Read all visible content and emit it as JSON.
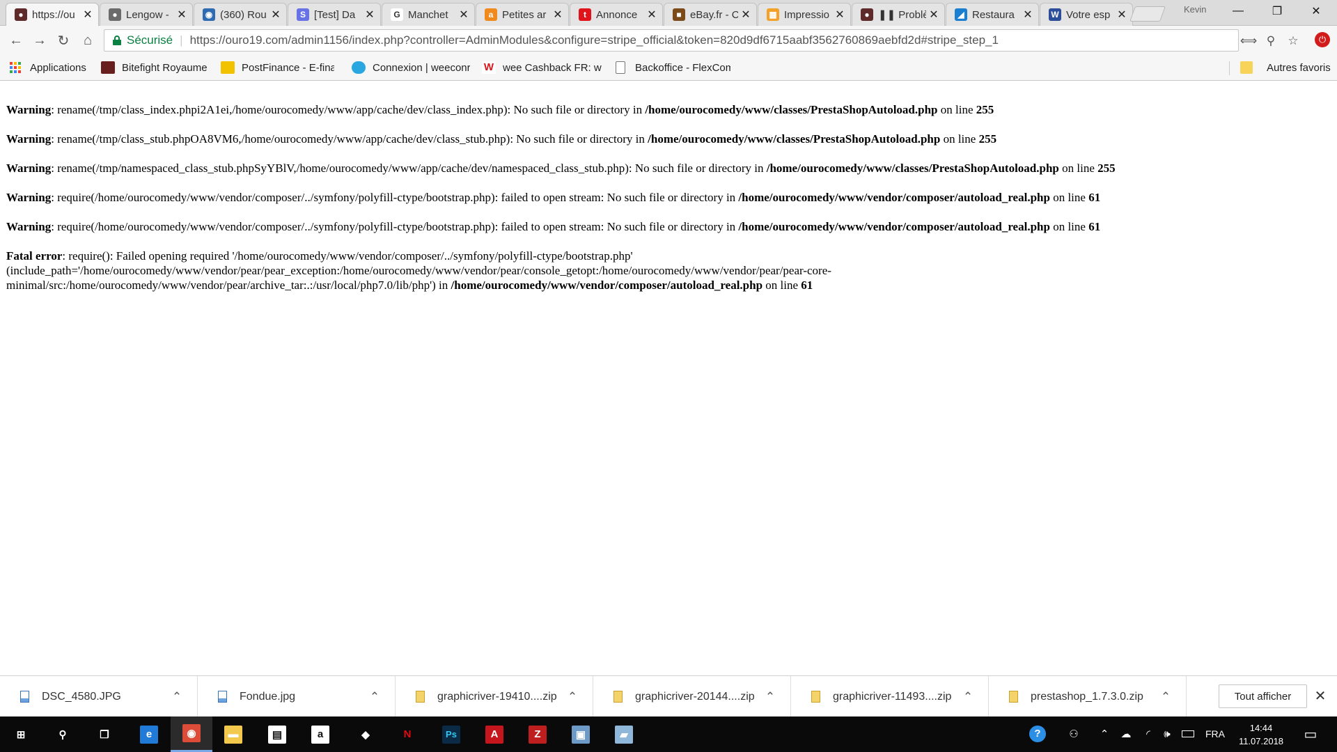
{
  "browser": {
    "tabs": [
      {
        "title": "https://ou",
        "favicon": "user-shield-icon",
        "color": "#5e2a2a",
        "glyph": "●",
        "active": true
      },
      {
        "title": "Lengow -",
        "favicon": "lengow-icon",
        "color": "#6b6b6b",
        "glyph": "●"
      },
      {
        "title": "(360) Rou",
        "favicon": "globe-icon",
        "color": "#2f6bb3",
        "glyph": "◉"
      },
      {
        "title": "[Test] Da",
        "favicon": "stripe-icon",
        "color": "#6772e5",
        "glyph": "S"
      },
      {
        "title": "Manchet",
        "favicon": "google-icon",
        "color": "#ffffff",
        "glyph": "G"
      },
      {
        "title": "Petites ar",
        "favicon": "anibis-icon",
        "color": "#f08a1c",
        "glyph": "a"
      },
      {
        "title": "Annonce",
        "favicon": "tutti-icon",
        "color": "#e2141b",
        "glyph": "t"
      },
      {
        "title": "eBay.fr - C",
        "favicon": "ebay-icon",
        "color": "#7a4a1a",
        "glyph": "■"
      },
      {
        "title": "Impressio",
        "favicon": "grid-icon",
        "color": "#f4a12a",
        "glyph": "▦"
      },
      {
        "title": "❚❚ Problè",
        "favicon": "user-shield-icon",
        "color": "#5e2a2a",
        "glyph": "●"
      },
      {
        "title": "Restaura",
        "favicon": "restaurant-icon",
        "color": "#1a7fd1",
        "glyph": "◢"
      },
      {
        "title": "Votre esp",
        "favicon": "vw-icon",
        "color": "#2c4e9a",
        "glyph": "W"
      }
    ],
    "profile_name": "Kevin",
    "window_controls": {
      "minimize": "—",
      "maximize": "❐",
      "close": "✕"
    },
    "secure_label": "Sécurisé",
    "url": "https://ouro19.com/admin1156/index.php?controller=AdminModules&configure=stripe_official&token=820d9df6715aabf3562760869aebfd2d#stripe_step_1",
    "bookmarks": [
      {
        "label": "Applications",
        "icon": "apps-grid-icon"
      },
      {
        "label": "Bitefight Royaume",
        "icon": "bitefight-icon",
        "color": "#6a1f1f"
      },
      {
        "label": "PostFinance - E-finar",
        "icon": "postfinance-icon",
        "color": "#f2c200"
      },
      {
        "label": "Connexion | weeconr",
        "icon": "salesforce-cloud-icon",
        "color": "#2aa6e0"
      },
      {
        "label": "wee Cashback FR: we",
        "icon": "wee-icon",
        "color": "#d6161c"
      },
      {
        "label": "Backoffice - FlexCom",
        "icon": "page-icon",
        "color": "#ffffff"
      }
    ],
    "other_bookmarks": "Autres favoris"
  },
  "page": {
    "messages": [
      {
        "level": "Warning",
        "text": ": rename(/tmp/class_index.phpi2A1ei,/home/ourocomedy/www/app/cache/dev/class_index.php): No such file or directory in ",
        "file": "/home/ourocomedy/www/classes/PrestaShopAutoload.php",
        "on_line": " on line ",
        "line": "255"
      },
      {
        "level": "Warning",
        "text": ": rename(/tmp/class_stub.phpOA8VM6,/home/ourocomedy/www/app/cache/dev/class_stub.php): No such file or directory in ",
        "file": "/home/ourocomedy/www/classes/PrestaShopAutoload.php",
        "on_line": " on line ",
        "line": "255"
      },
      {
        "level": "Warning",
        "text": ": rename(/tmp/namespaced_class_stub.phpSyYBlV,/home/ourocomedy/www/app/cache/dev/namespaced_class_stub.php): No such file or directory in ",
        "file": "/home/ourocomedy/www/classes/PrestaShopAutoload.php",
        "on_line": " on line ",
        "line": "255"
      },
      {
        "level": "Warning",
        "text": ": require(/home/ourocomedy/www/vendor/composer/../symfony/polyfill-ctype/bootstrap.php): failed to open stream: No such file or directory in ",
        "file": "/home/ourocomedy/www/vendor/composer/autoload_real.php",
        "on_line": " on line ",
        "line": "61"
      },
      {
        "level": "Warning",
        "text": ": require(/home/ourocomedy/www/vendor/composer/../symfony/polyfill-ctype/bootstrap.php): failed to open stream: No such file or directory in ",
        "file": "/home/ourocomedy/www/vendor/composer/autoload_real.php",
        "on_line": " on line ",
        "line": "61"
      }
    ],
    "fatal": {
      "level": "Fatal error",
      "text": ": require(): Failed opening required '/home/ourocomedy/www/vendor/composer/../symfony/polyfill-ctype/bootstrap.php' (include_path='/home/ourocomedy/www/vendor/pear/pear_exception:/home/ourocomedy/www/vendor/pear/console_getopt:/home/ourocomedy/www/vendor/pear/pear-core-minimal/src:/home/ourocomedy/www/vendor/pear/archive_tar:.:/usr/local/php7.0/lib/php') in ",
      "file": "/home/ourocomedy/www/vendor/composer/autoload_real.php",
      "on_line": " on line ",
      "line": "61"
    }
  },
  "downloads": {
    "items": [
      {
        "name": "DSC_4580.JPG",
        "type": "img"
      },
      {
        "name": "Fondue.jpg",
        "type": "img"
      },
      {
        "name": "graphicriver-19410....zip",
        "type": "zip"
      },
      {
        "name": "graphicriver-20144....zip",
        "type": "zip"
      },
      {
        "name": "graphicriver-11493....zip",
        "type": "zip"
      },
      {
        "name": "prestashop_1.7.3.0.zip",
        "type": "zip"
      }
    ],
    "show_all": "Tout afficher"
  },
  "taskbar": {
    "apps": [
      {
        "name": "start-icon",
        "glyph": "⊞",
        "color": "#0a0a0a"
      },
      {
        "name": "search-icon",
        "glyph": "⚲",
        "color": "#0a0a0a"
      },
      {
        "name": "task-view-icon",
        "glyph": "❐",
        "color": "#0a0a0a"
      },
      {
        "name": "edge-icon",
        "glyph": "e",
        "color": "#1f7ad8"
      },
      {
        "name": "chrome-icon",
        "glyph": "◉",
        "color": "#dd4b39",
        "active": true
      },
      {
        "name": "file-explorer-icon",
        "glyph": "▬",
        "color": "#f2c94c"
      },
      {
        "name": "store-icon",
        "glyph": "▤",
        "color": "#ffffff"
      },
      {
        "name": "amazon-icon",
        "glyph": "a",
        "color": "#ffffff"
      },
      {
        "name": "dropbox-icon",
        "glyph": "◆",
        "color": "#0a0a0a"
      },
      {
        "name": "netflix-icon",
        "glyph": "N",
        "color": "#0a0a0a"
      },
      {
        "name": "photoshop-icon",
        "glyph": "Ps",
        "color": "#0b2a46"
      },
      {
        "name": "acrobat-icon",
        "glyph": "A",
        "color": "#c4161c"
      },
      {
        "name": "filezilla-icon",
        "glyph": "Z",
        "color": "#bf1e1e"
      },
      {
        "name": "photos-icon",
        "glyph": "▣",
        "color": "#6e9ac8"
      },
      {
        "name": "notes-icon",
        "glyph": "▰",
        "color": "#8fb7d9"
      }
    ],
    "language": "FRA",
    "time": "14:44",
    "date": "11.07.2018"
  }
}
